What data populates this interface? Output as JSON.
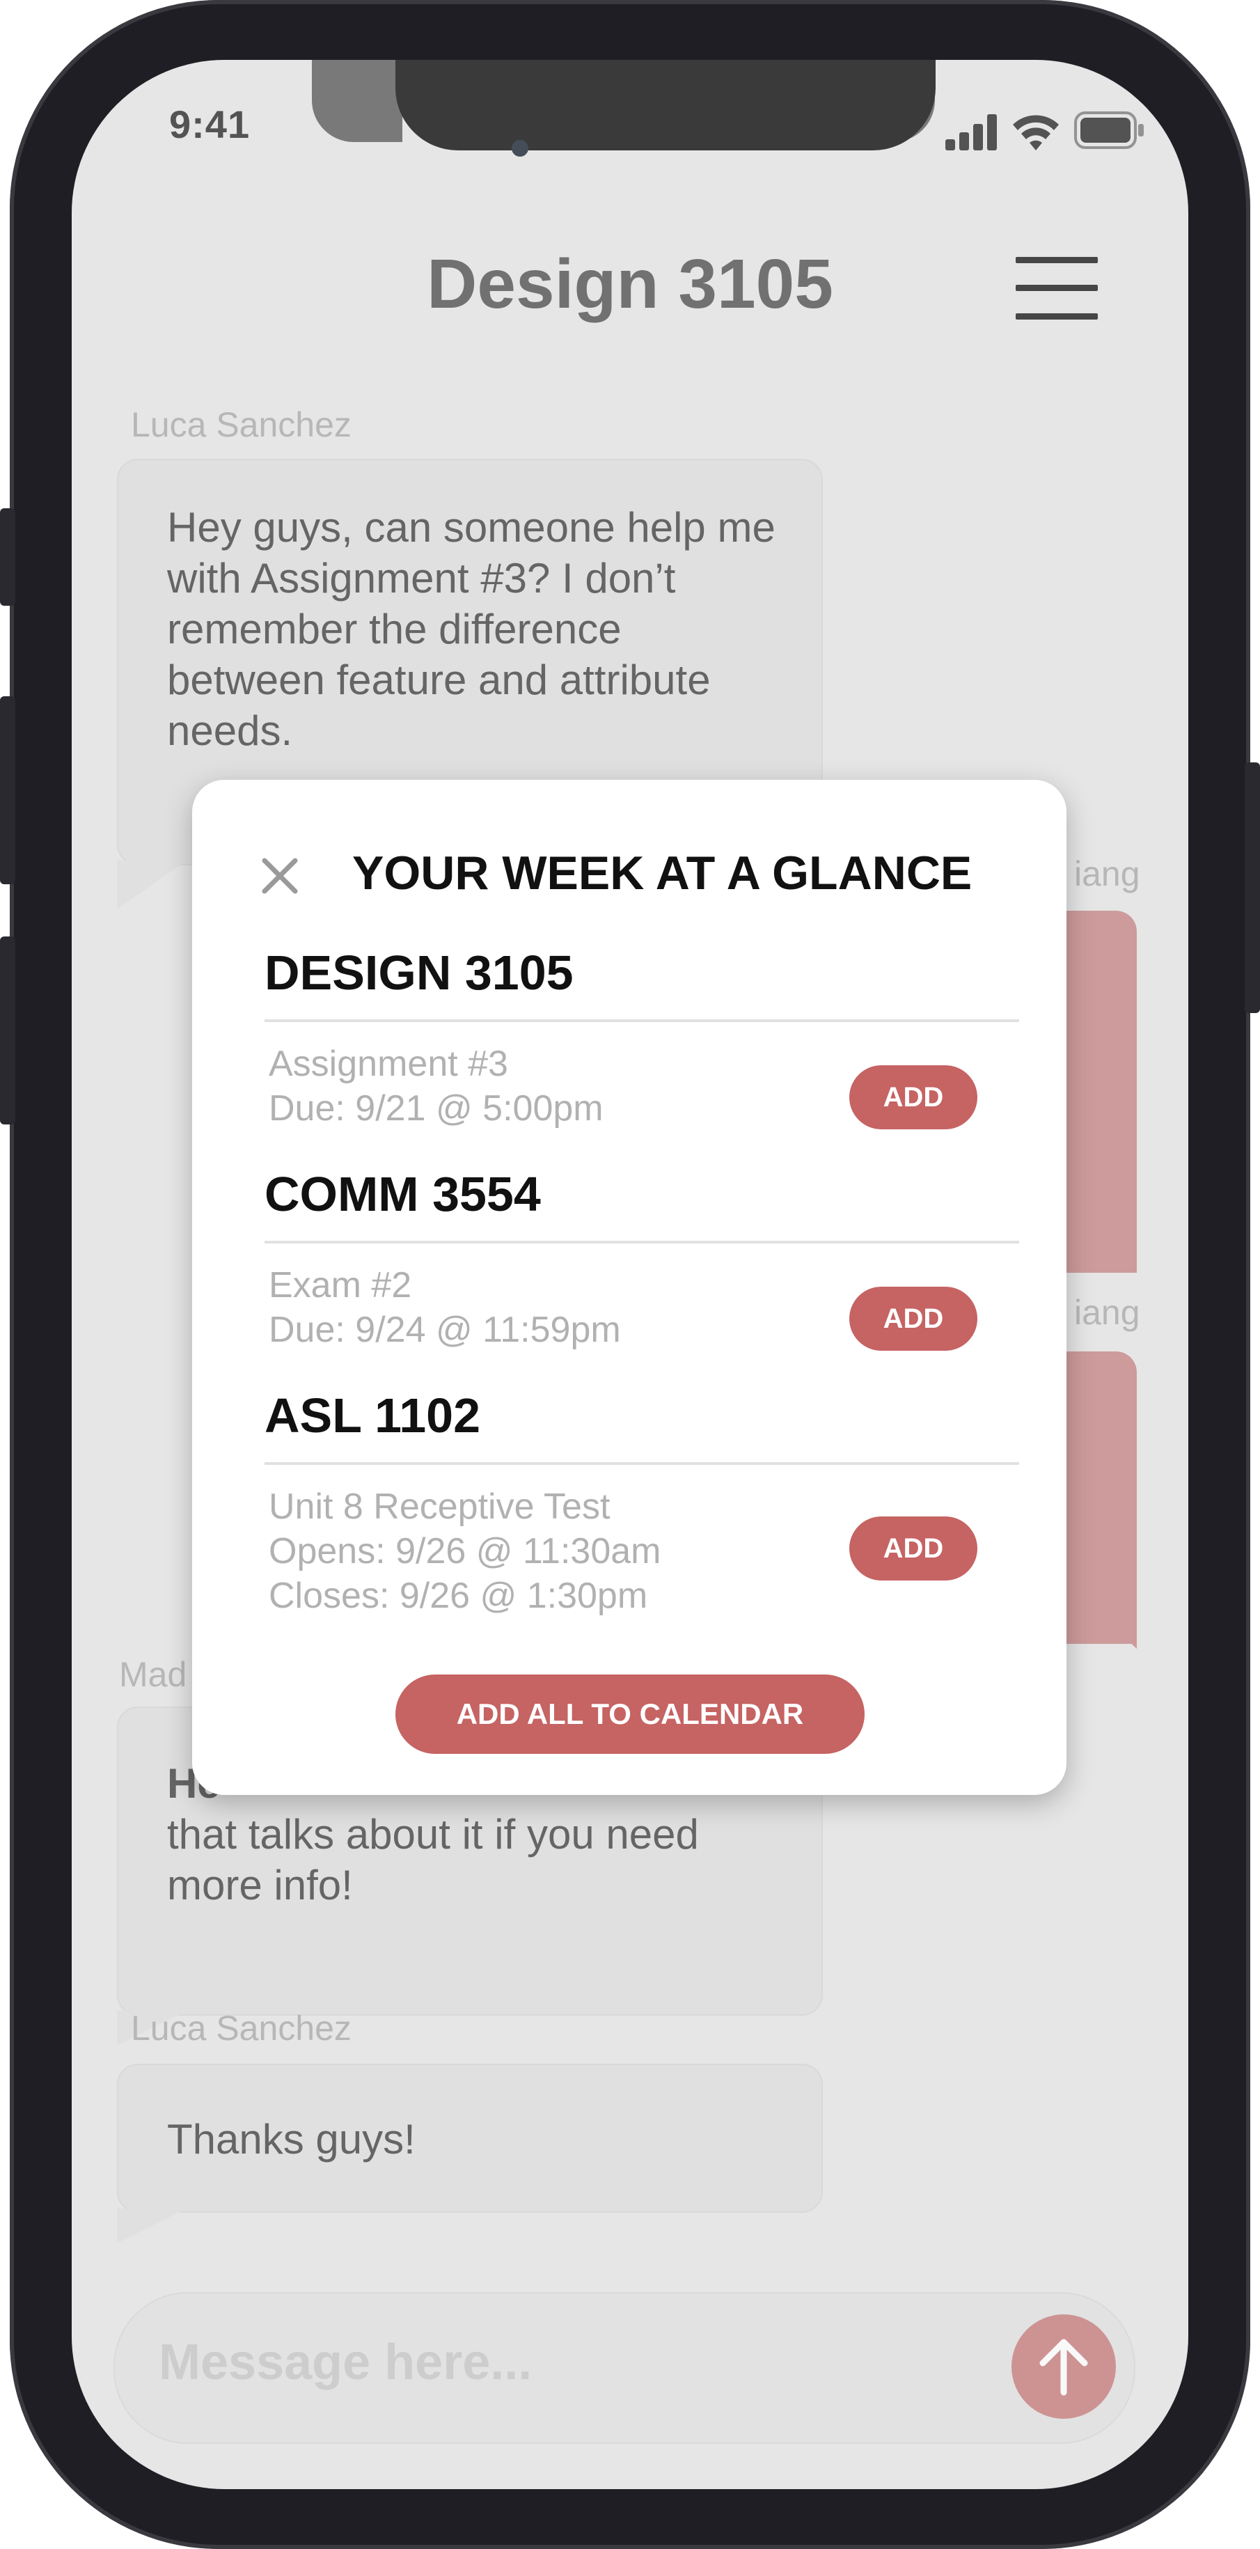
{
  "status_bar": {
    "time": "9:41"
  },
  "header": {
    "title": "Design 3105"
  },
  "messages": [
    {
      "sender": "Luca Sanchez",
      "text": "Hey guys, can someone help me with Assignment #3? I don’t remember the difference between feature and attribute needs."
    },
    {
      "sender_partial": "iang"
    },
    {
      "sender_partial": "iang"
    },
    {
      "sender_partial": "Mad",
      "text_line1": "He",
      "text_rest": "that talks about it if you need more info!"
    },
    {
      "sender": "Luca Sanchez",
      "text": "Thanks guys!"
    }
  ],
  "composer": {
    "placeholder": "Message here..."
  },
  "modal": {
    "title": "YOUR WEEK AT A GLANCE",
    "courses": [
      {
        "name": "DESIGN 3105",
        "lines": [
          "Assignment #3",
          "Due: 9/21 @ 5:00pm"
        ],
        "button": "ADD"
      },
      {
        "name": "COMM 3554",
        "lines": [
          "Exam #2",
          "Due: 9/24 @ 11:59pm"
        ],
        "button": "ADD"
      },
      {
        "name": "ASL 1102",
        "lines": [
          "Unit 8 Receptive Test",
          "Opens: 9/26 @ 11:30am",
          "Closes: 9/26 @ 1:30pm"
        ],
        "button": "ADD"
      }
    ],
    "add_all": "ADD ALL TO CALENDAR"
  },
  "colors": {
    "accent": "#c66363",
    "accent_muted": "#c48282",
    "screen_bg": "#e6e6e6"
  }
}
